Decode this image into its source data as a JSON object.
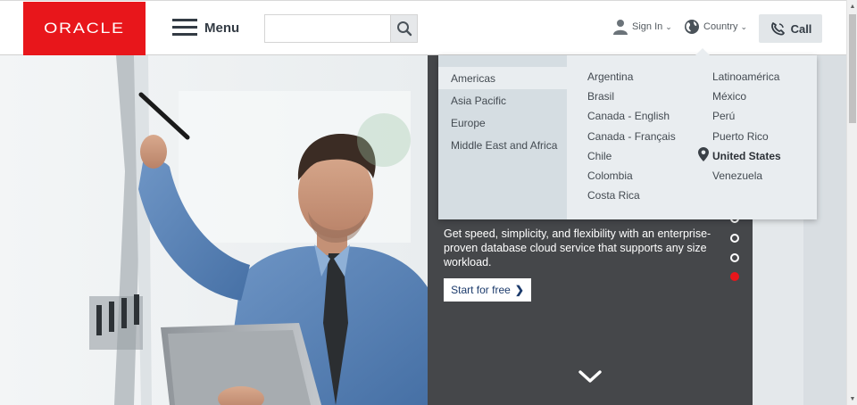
{
  "header": {
    "logo_text": "ORACLE",
    "menu_label": "Menu",
    "search_placeholder": "",
    "sign_in_label": "Sign In",
    "country_label": "Country",
    "call_label": "Call"
  },
  "hero": {
    "text": "Get speed, simplicity, and flexibility with an enterprise-proven database cloud service that supports any size workload.",
    "cta_label": "Start for free",
    "cta_arrow": "❯",
    "slides": [
      {
        "active": false
      },
      {
        "active": false
      },
      {
        "active": false
      },
      {
        "active": true
      }
    ]
  },
  "country_dropdown": {
    "regions": [
      "Americas",
      "Asia Pacific",
      "Europe",
      "Middle East and Africa"
    ],
    "active_region": "Americas",
    "countries_col1": [
      "Argentina",
      "Brasil",
      "Canada - English",
      "Canada - Français",
      "Chile",
      "Colombia",
      "Costa Rica"
    ],
    "countries_col2": [
      "Latinoamérica",
      "México",
      "Perú",
      "Puerto Rico",
      "United States",
      "Venezuela"
    ],
    "selected_country": "United States"
  },
  "colors": {
    "brand_red": "#e8161b",
    "dark_text": "#333b44",
    "panel_dark": "#45474a",
    "dropdown_bg": "#e9edf0",
    "region_bg": "#d5dde2"
  },
  "icons": {
    "search": "search-icon",
    "user": "user-icon",
    "globe": "globe-icon",
    "phone": "phone-icon",
    "pin": "map-pin-icon",
    "chevron": "chevron-down-icon"
  }
}
